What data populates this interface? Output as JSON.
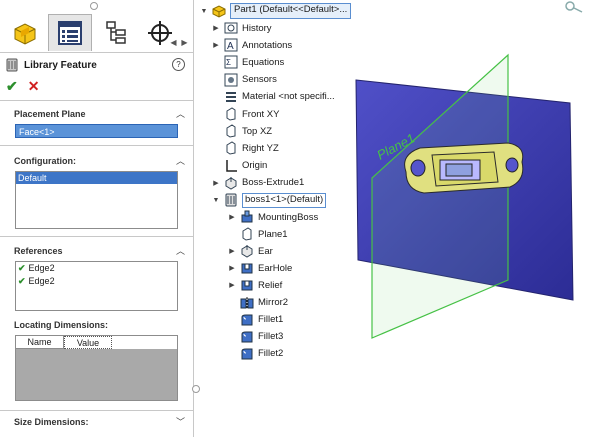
{
  "panel": {
    "tabs": [
      {
        "icon": "feature-manager-icon",
        "active": false
      },
      {
        "icon": "property-manager-icon",
        "active": true
      },
      {
        "icon": "configuration-manager-icon",
        "active": false
      },
      {
        "icon": "dimxpert-manager-icon",
        "active": false
      }
    ],
    "title": "Library Feature",
    "help": "?",
    "ok": "✔",
    "cancel": "✕",
    "placement_plane": {
      "label": "Placement Plane",
      "value": "Face<1>"
    },
    "configuration": {
      "label": "Configuration:",
      "selected": "Default"
    },
    "references": {
      "label": "References",
      "items": [
        "Edge2",
        "Edge2"
      ]
    },
    "locating_dimensions": {
      "label": "Locating Dimensions:",
      "columns": [
        "Name",
        "Value"
      ]
    },
    "size_dimensions": {
      "label": "Size Dimensions:"
    }
  },
  "tree": {
    "root": "Part1  (Default<<Default>...",
    "items": [
      {
        "label": "History",
        "icon": "history-icon",
        "expander": "▶"
      },
      {
        "label": "Annotations",
        "icon": "annotations-icon",
        "expander": "▶"
      },
      {
        "label": "Equations",
        "icon": "equations-icon",
        "expander": ""
      },
      {
        "label": "Sensors",
        "icon": "sensors-icon",
        "expander": ""
      },
      {
        "label": "Material <not specifi...",
        "icon": "material-icon",
        "expander": ""
      },
      {
        "label": "Front XY",
        "icon": "plane-icon",
        "expander": ""
      },
      {
        "label": "Top XZ",
        "icon": "plane-icon",
        "expander": ""
      },
      {
        "label": "Right YZ",
        "icon": "plane-icon",
        "expander": ""
      },
      {
        "label": "Origin",
        "icon": "origin-icon",
        "expander": ""
      },
      {
        "label": "Boss-Extrude1",
        "icon": "extrude-icon",
        "expander": "▶"
      },
      {
        "label": "boss1<1>(Default)",
        "icon": "library-feature-icon",
        "expander": "▼"
      }
    ],
    "children": [
      {
        "label": "MountingBoss",
        "icon": "mounting-boss-icon",
        "expander": "▶"
      },
      {
        "label": "Plane1",
        "icon": "plane-icon",
        "expander": ""
      },
      {
        "label": "Ear",
        "icon": "extrude-icon",
        "expander": "▶"
      },
      {
        "label": "EarHole",
        "icon": "cut-icon",
        "expander": "▶"
      },
      {
        "label": "Relief",
        "icon": "cut-icon",
        "expander": "▶"
      },
      {
        "label": "Mirror2",
        "icon": "mirror-icon",
        "expander": ""
      },
      {
        "label": "Fillet1",
        "icon": "fillet-icon",
        "expander": ""
      },
      {
        "label": "Fillet3",
        "icon": "fillet-icon",
        "expander": ""
      },
      {
        "label": "Fillet2",
        "icon": "fillet-icon",
        "expander": ""
      }
    ]
  },
  "viewport": {
    "plane_label": "Plane1"
  },
  "colors": {
    "accent": "#3d75c7",
    "face": "#3e3eb0",
    "plane_edge": "#46c146",
    "part": "#e0e080"
  }
}
